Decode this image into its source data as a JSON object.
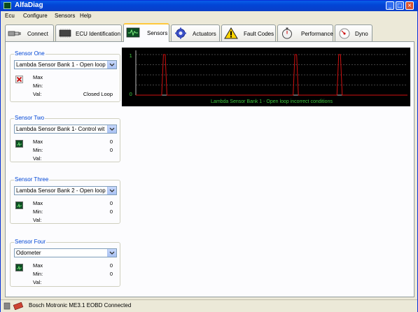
{
  "window": {
    "title": "AlfaDiag",
    "min_glyph": "_",
    "max_glyph": "□",
    "close_glyph": "×"
  },
  "menu": [
    "Ecu",
    "Configure",
    "Sensors",
    "Help"
  ],
  "tabs": [
    {
      "label": "Connect",
      "icon": "connect-plug-icon"
    },
    {
      "label": "ECU Identification",
      "icon": "chip-icon"
    },
    {
      "label": "Sensors",
      "icon": "monitor-wave-icon",
      "active": true
    },
    {
      "label": "Actuators",
      "icon": "gear-icon"
    },
    {
      "label": "Fault Codes",
      "icon": "warning-icon"
    },
    {
      "label": "Performance",
      "icon": "stopwatch-icon"
    },
    {
      "label": "Dyno",
      "icon": "gauge-icon"
    }
  ],
  "sensors": [
    {
      "title": "Sensor One",
      "selected": "Lambda Sensor Bank 1 - Open loop",
      "max_label": "Max",
      "min_label": "Min:",
      "val_label": "Val:",
      "max": "",
      "min": "",
      "val": "Closed Loop",
      "button_state": "disabled"
    },
    {
      "title": "Sensor Two",
      "selected": "Lambda Sensor Bank 1- Control wit",
      "max_label": "Max",
      "min_label": "Min:",
      "val_label": "Val:",
      "max": "0",
      "min": "0",
      "val": "",
      "button_state": "chart"
    },
    {
      "title": "Sensor Three",
      "selected": "Lambda Sensor Bank 2 - Open loop",
      "max_label": "Max",
      "min_label": "Min:",
      "val_label": "Val:",
      "max": "0",
      "min": "0",
      "val": "",
      "button_state": "chart"
    },
    {
      "title": "Sensor Four",
      "selected": "Odometer",
      "max_label": "Max",
      "min_label": "Min:",
      "val_label": "Val:",
      "max": "0",
      "min": "0",
      "val": "",
      "button_state": "chart"
    }
  ],
  "chart_data": {
    "type": "line",
    "title": "Lambda Sensor Bank 1 - Open loop incorrect conditions",
    "ytick_labels": [
      "1",
      "0"
    ],
    "ylim": [
      0,
      1
    ],
    "x": [
      0,
      1,
      2,
      3,
      4,
      5,
      6,
      7,
      8,
      9,
      10,
      11,
      12,
      13,
      14,
      15,
      16,
      17,
      18,
      19,
      20
    ],
    "series": [
      {
        "values": [
          0,
          0,
          0,
          0,
          0,
          1,
          0,
          0,
          0,
          0,
          0,
          0,
          0,
          0,
          0,
          0,
          0,
          0,
          0,
          0,
          0
        ]
      }
    ],
    "spike_x": [
      6.5,
      36.5,
      46.5
    ],
    "xlim": [
      0,
      62
    ],
    "line_color": "#d01010",
    "grid": true,
    "title_color": "#3ec93e"
  },
  "status": {
    "text": "Bosch Motronic ME3.1 EOBD Connected"
  }
}
